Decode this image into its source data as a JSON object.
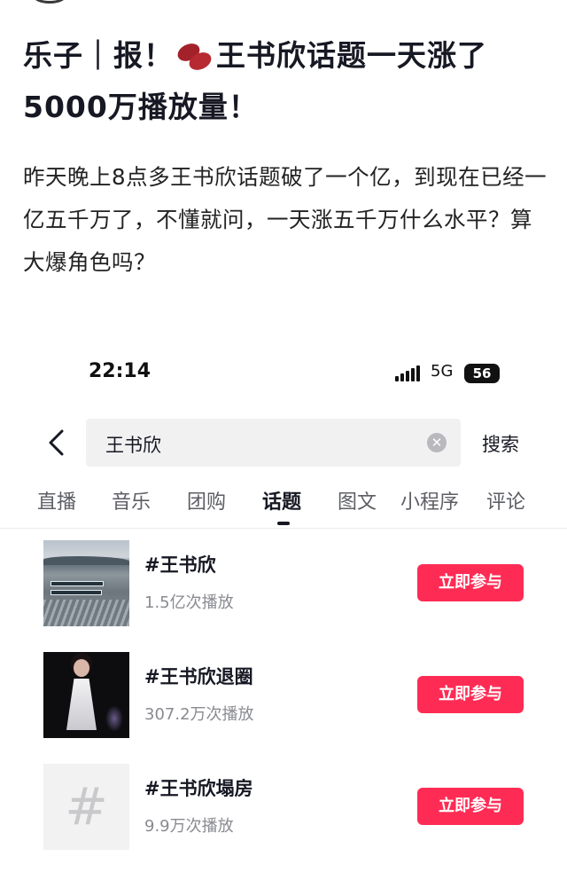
{
  "post": {
    "title_part1": "乐子｜报！",
    "title_part2": "王书欣话题一天涨了5000万播放量！",
    "body": "昨天晚上8点多王书欣话题破了一个亿，到现在已经一亿五千万了，不懂就问，一天涨五千万什么水平？算大爆角色吗？"
  },
  "status_bar": {
    "time": "22:14",
    "network": "5G",
    "battery": "56"
  },
  "search": {
    "query": "王书欣",
    "submit_label": "搜索"
  },
  "tabs": [
    {
      "label": "直播"
    },
    {
      "label": "音乐"
    },
    {
      "label": "团购"
    },
    {
      "label": "话题",
      "active": true
    },
    {
      "label": "图文"
    },
    {
      "label": "小程序"
    },
    {
      "label": "评论"
    }
  ],
  "topics": [
    {
      "title": "#王书欣",
      "plays": "1.5亿次播放",
      "action": "立即参与",
      "thumb": "lake-photo"
    },
    {
      "title": "#王书欣退圈",
      "plays": "307.2万次播放",
      "action": "立即参与",
      "thumb": "stage-photo"
    },
    {
      "title": "#王书欣塌房",
      "plays": "9.9万次播放",
      "action": "立即参与",
      "thumb": "hash-placeholder"
    }
  ],
  "icons": {
    "bean": "red-bean-emoji",
    "back": "chevron-left-icon",
    "clear": "clear-x-icon",
    "placeholder": "#"
  },
  "colors": {
    "accent": "#fe2c55",
    "text": "#161823",
    "muted": "#8a8b91"
  }
}
